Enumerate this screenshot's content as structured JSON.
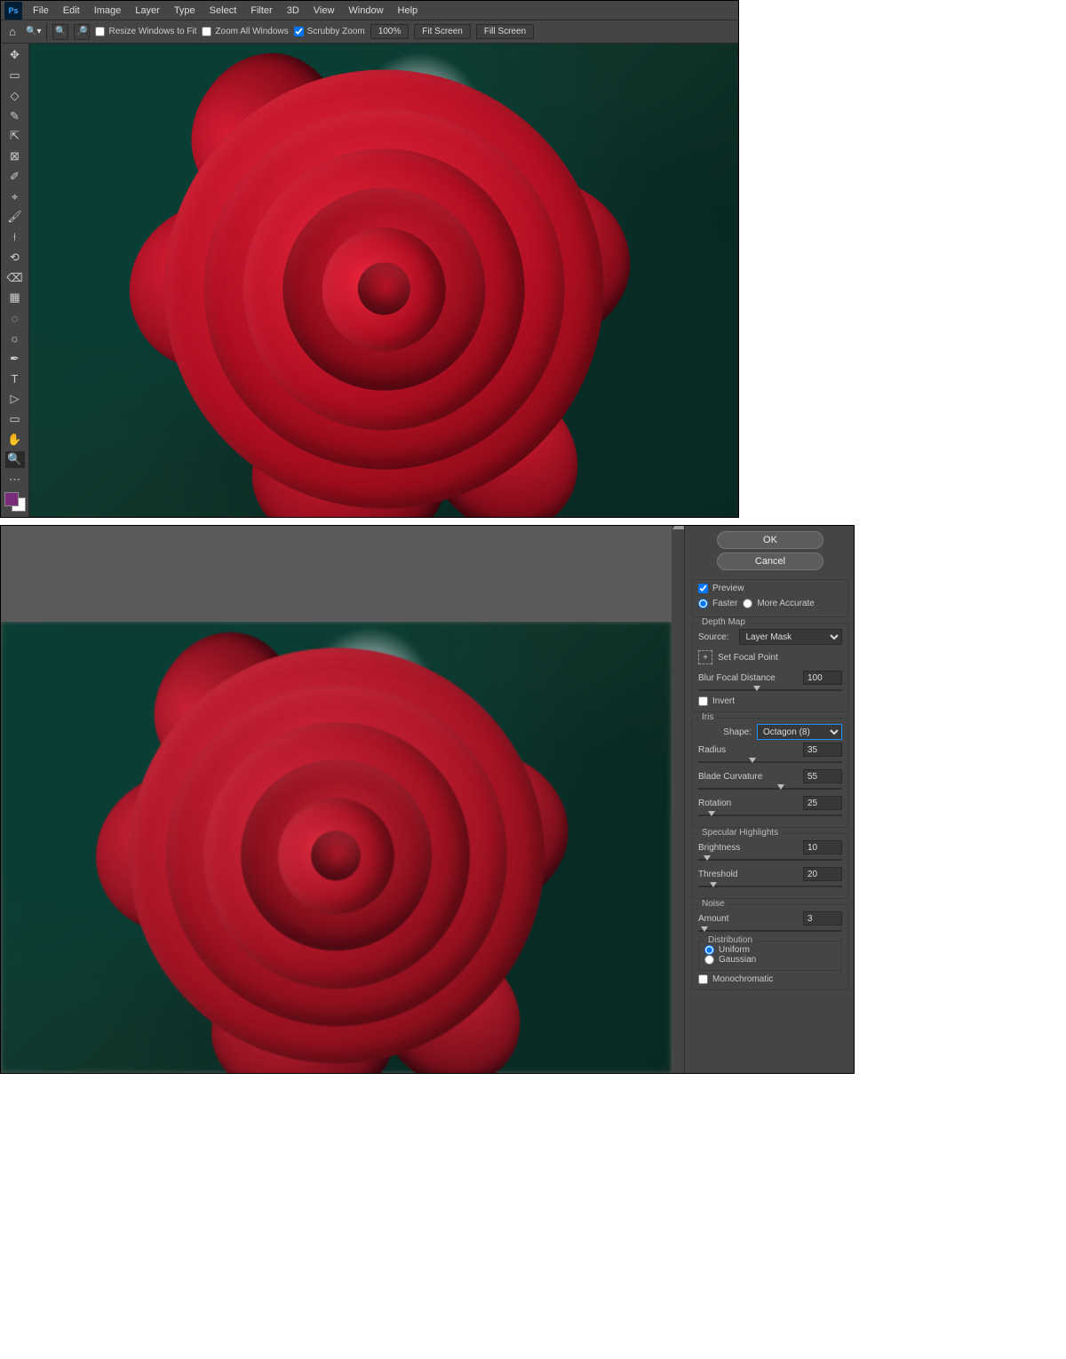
{
  "menu": {
    "items": [
      "File",
      "Edit",
      "Image",
      "Layer",
      "Type",
      "Select",
      "Filter",
      "3D",
      "View",
      "Window",
      "Help"
    ]
  },
  "optbar": {
    "resize": "Resize Windows to Fit",
    "zoomAll": "Zoom All Windows",
    "scrubby": "Scrubby Zoom",
    "zoomPct": "100%",
    "fit": "Fit Screen",
    "fill": "Fill Screen"
  },
  "tools": [
    "✥",
    "▭",
    "◇",
    "✎",
    "⇱",
    "⊠",
    "✐",
    "⌖",
    "✓",
    "🖌",
    "⟊",
    "⌫",
    "⬚",
    "◌",
    "✒",
    "T",
    "▷",
    "✋",
    "▭",
    "🔍",
    "⋯"
  ],
  "dialog": {
    "ok": "OK",
    "cancel": "Cancel",
    "preview": "Preview",
    "faster": "Faster",
    "moreAccurate": "More Accurate",
    "depthMap": {
      "title": "Depth Map",
      "sourceLabel": "Source:",
      "source": "Layer Mask",
      "setFocal": "Set Focal Point",
      "bfd": "Blur Focal Distance",
      "bfdVal": "100",
      "invert": "Invert"
    },
    "iris": {
      "title": "Iris",
      "shapeLabel": "Shape:",
      "shape": "Octagon (8)",
      "radius": "Radius",
      "radiusVal": "35",
      "blade": "Blade Curvature",
      "bladeVal": "55",
      "rotation": "Rotation",
      "rotationVal": "25"
    },
    "spec": {
      "title": "Specular Highlights",
      "brightness": "Brightness",
      "brightnessVal": "10",
      "threshold": "Threshold",
      "thresholdVal": "20"
    },
    "noise": {
      "title": "Noise",
      "amount": "Amount",
      "amountVal": "3",
      "distribution": "Distribution",
      "uniform": "Uniform",
      "gaussian": "Gaussian",
      "mono": "Monochromatic"
    }
  }
}
